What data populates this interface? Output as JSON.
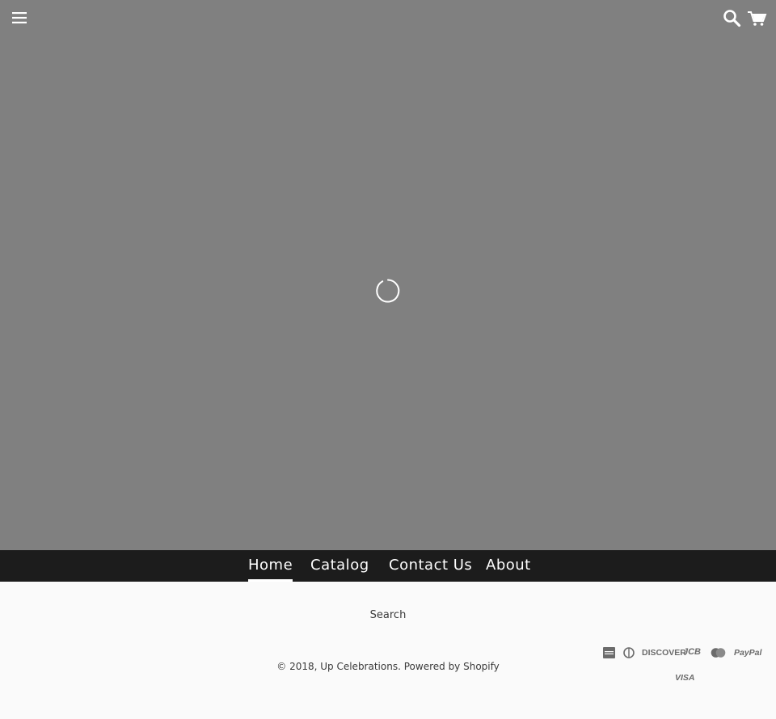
{
  "header": {
    "menu_icon": "hamburger-menu-icon",
    "search_icon": "search-icon",
    "cart_icon": "cart-icon"
  },
  "hero": {
    "background_color": "#808080",
    "loading_icon": "spinner-icon"
  },
  "nav": {
    "background_color": "#1c1c1c",
    "items": [
      {
        "label": "Home",
        "active": true
      },
      {
        "label": "Catalog",
        "active": false
      },
      {
        "label": "Contact Us",
        "active": false
      },
      {
        "label": "About",
        "active": false
      }
    ]
  },
  "footer": {
    "search_label": "Search",
    "copyright_prefix": "© 2018,",
    "store_name": "Up Celebrations",
    "powered_by": "Powered by Shopify",
    "payment_icons": [
      {
        "icon": "american-express-icon"
      },
      {
        "icon": "diners-club-icon"
      },
      {
        "icon": "discover-icon",
        "label": "DISCOVER"
      },
      {
        "icon": "jcb-icon",
        "label": "JCB"
      },
      {
        "icon": "master-icon"
      },
      {
        "icon": "paypal-icon",
        "label": "PayPal"
      },
      {
        "icon": "visa-icon",
        "label": "VISA"
      }
    ]
  }
}
